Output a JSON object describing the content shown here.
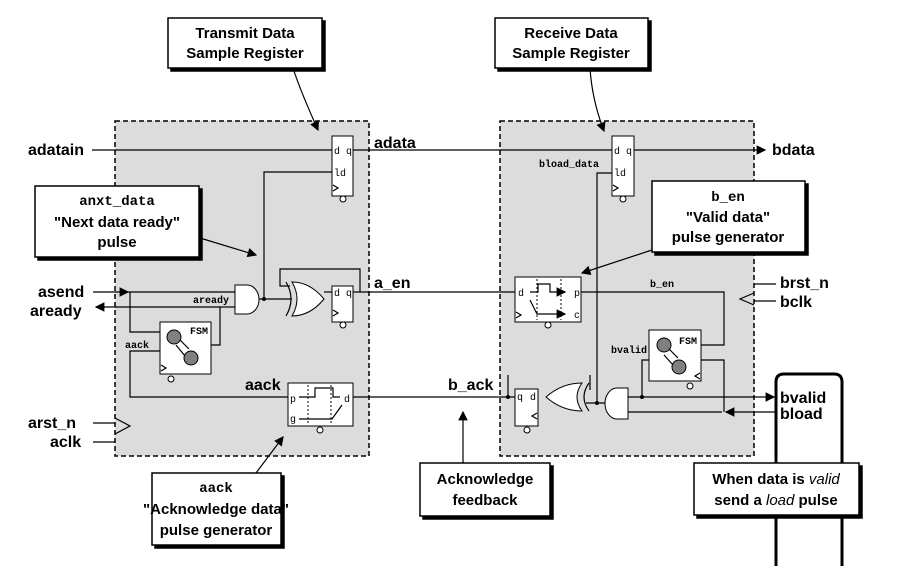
{
  "callouts": {
    "tx_reg": [
      "Transmit Data",
      "Sample Register"
    ],
    "rx_reg": [
      "Receive Data",
      "Sample Register"
    ],
    "anxt": {
      "signal": "anxt_data",
      "line1": "\"Next data ready\"",
      "line2": "pulse"
    },
    "ben": {
      "signal": "b_en",
      "line1": "\"Valid data\"",
      "line2": "pulse generator"
    },
    "aack": {
      "signal": "aack",
      "line1": "\"Acknowledge data\"",
      "line2": "pulse generator"
    },
    "ackfb": [
      "Acknowledge",
      "feedback"
    ],
    "valid": {
      "pre": "When data is ",
      "valid": "valid",
      "mid": "send a ",
      "load": "load",
      "post": " pulse"
    }
  },
  "signals": {
    "adatain": "adatain",
    "adata": "adata",
    "bdata": "bdata",
    "asend": "asend",
    "aready": "aready",
    "aready_int": "aready",
    "a_en": "a_en",
    "aack_int": "aack",
    "aack": "aack",
    "arst_n": "arst_n",
    "aclk": "aclk",
    "bload_data": "bload_data",
    "b_en": "b_en",
    "brst_n": "brst_n",
    "bclk": "bclk",
    "bvalid_int": "bvalid",
    "b_ack": "b_ack",
    "bvalid": "bvalid",
    "bload": "bload"
  },
  "blocks": {
    "fsm": "FSM",
    "pins": {
      "d": "d",
      "q": "q",
      "ld": "ld",
      "p": "p",
      "g": "g",
      "c": "c"
    }
  }
}
